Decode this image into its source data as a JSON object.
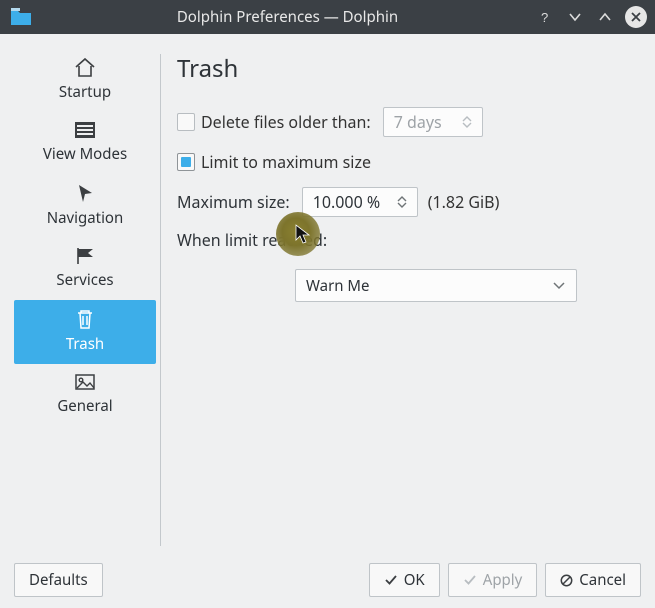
{
  "titlebar": {
    "title": "Dolphin Preferences — Dolphin"
  },
  "sidebar": {
    "items": [
      {
        "label": "Startup"
      },
      {
        "label": "View Modes"
      },
      {
        "label": "Navigation"
      },
      {
        "label": "Services"
      },
      {
        "label": "Trash"
      },
      {
        "label": "General"
      }
    ]
  },
  "page": {
    "title": "Trash",
    "delete_older_label": "Delete files older than:",
    "delete_older_value": "7 days",
    "limit_max_label": "Limit to maximum size",
    "max_size_label": "Maximum size:",
    "max_size_value": "10.000 %",
    "max_size_hint": "(1.82 GiB)",
    "when_limit_label": "When limit reached:",
    "when_limit_value": "Warn Me"
  },
  "footer": {
    "defaults": "Defaults",
    "ok": "OK",
    "apply": "Apply",
    "cancel": "Cancel"
  }
}
